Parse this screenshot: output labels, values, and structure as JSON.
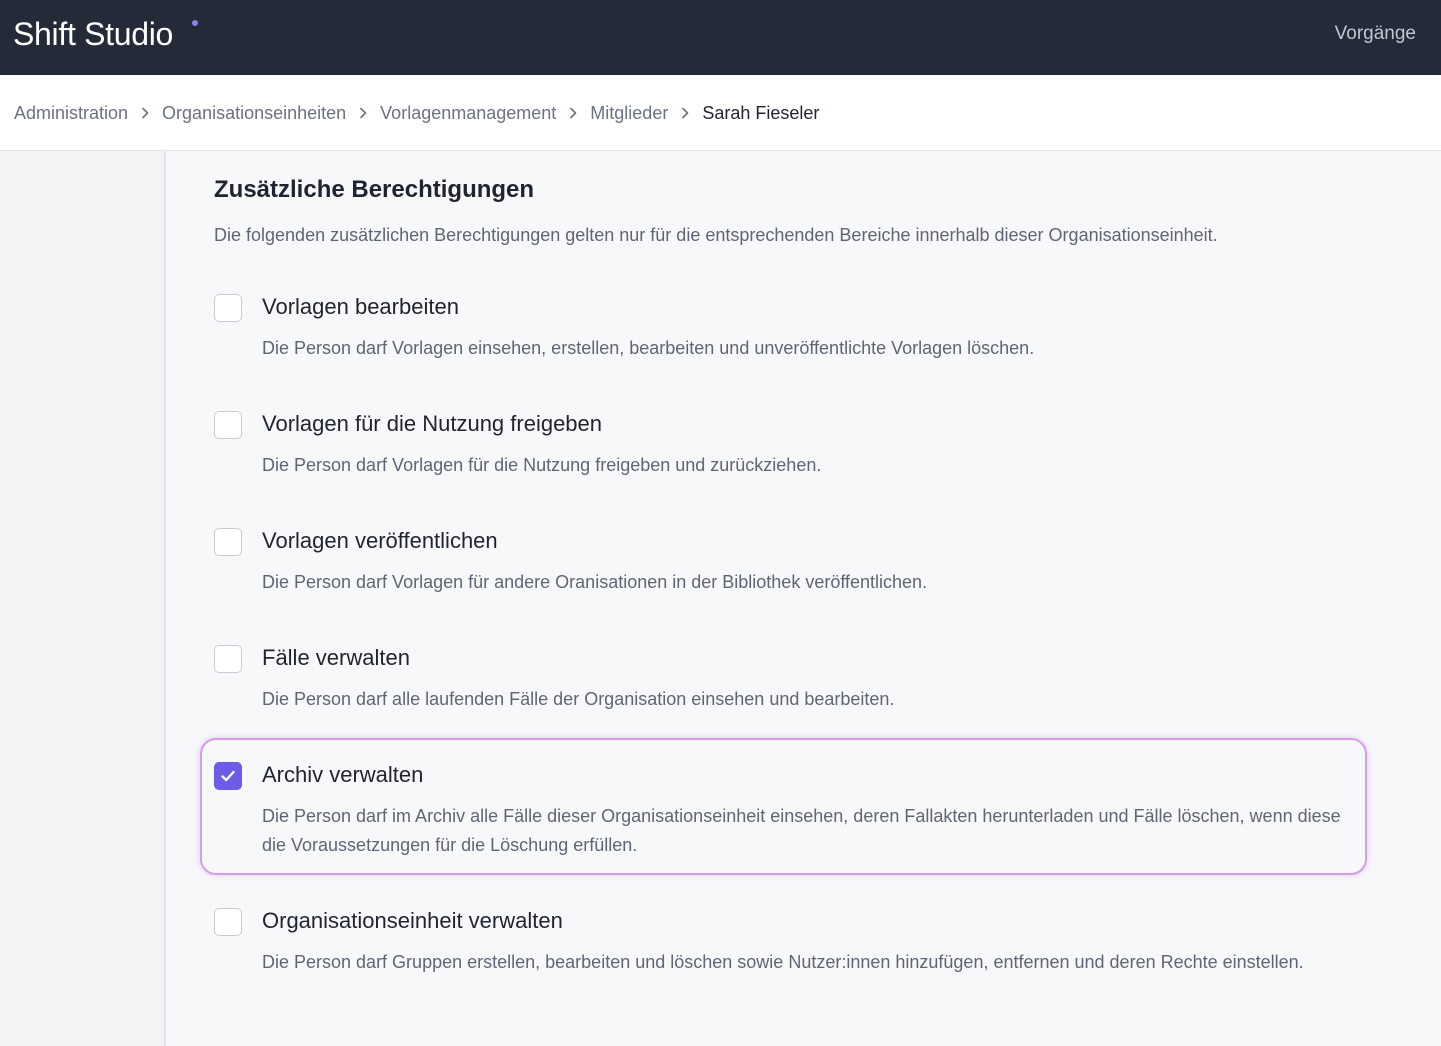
{
  "app": {
    "brand": "Shift Studio",
    "accent_color": "#6c5ce7",
    "highlight_color": "#d79ce8"
  },
  "topnav": {
    "link": "Vorgänge"
  },
  "breadcrumb": {
    "items": [
      "Administration",
      "Organisationseinheiten",
      "Vorlagenmanagement",
      "Mitglieder"
    ],
    "current": "Sarah Fieseler",
    "separator_icon": "chevron-right-icon"
  },
  "section": {
    "title": "Zusätzliche Berechtigungen",
    "description": "Die folgenden zusätzlichen Berechtigungen gelten nur für die entsprechenden Bereiche innerhalb dieser Organisationseinheit."
  },
  "permissions": [
    {
      "title": "Vorlagen bearbeiten",
      "description": "Die Person darf Vorlagen einsehen, erstellen, bearbeiten und unveröffentlichte Vorlagen löschen.",
      "checked": false
    },
    {
      "title": "Vorlagen für die Nutzung freigeben",
      "description": "Die Person darf Vorlagen für die Nutzung freigeben und zurückziehen.",
      "checked": false
    },
    {
      "title": "Vorlagen veröffentlichen",
      "description": "Die Person darf Vorlagen für andere Oranisationen in der Bibliothek veröffentlichen.",
      "checked": false
    },
    {
      "title": "Fälle verwalten",
      "description": "Die Person darf alle laufenden Fälle der Organisation einsehen und bearbeiten.",
      "checked": false
    },
    {
      "title": "Archiv verwalten",
      "description": "Die Person darf im Archiv alle Fälle dieser Organisationseinheit einsehen, deren Fallakten herunterladen und Fälle löschen, wenn diese die Voraussetzungen für die Löschung erfüllen.",
      "checked": true,
      "highlighted": true
    },
    {
      "title": "Organisationseinheit verwalten",
      "description": "Die Person darf Gruppen erstellen, bearbeiten und löschen sowie Nutzer:innen hinzufügen, entfernen und deren Rechte einstellen.",
      "checked": false
    }
  ]
}
